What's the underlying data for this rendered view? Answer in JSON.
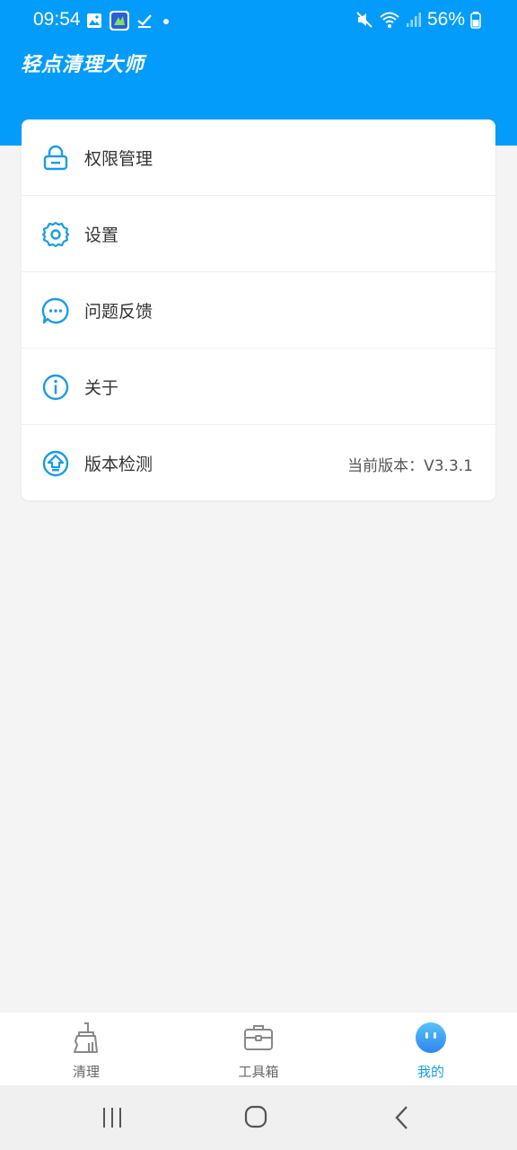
{
  "status_bar": {
    "time": "09:54",
    "battery": "56%",
    "left_icons": [
      "gallery-icon",
      "app-icon",
      "check-icon",
      "dot-icon"
    ],
    "right_icons": [
      "mute-icon",
      "wifi-icon",
      "signal-icon",
      "battery-icon"
    ]
  },
  "header": {
    "title": "轻点清理大师",
    "color": "#039cfa"
  },
  "menu": {
    "items": [
      {
        "label": "权限管理",
        "icon": "lock-icon"
      },
      {
        "label": "设置",
        "icon": "gear-icon"
      },
      {
        "label": "问题反馈",
        "icon": "chat-icon"
      },
      {
        "label": "关于",
        "icon": "info-icon"
      },
      {
        "label": "版本检测",
        "icon": "upgrade-icon",
        "extra": "当前版本：V3.3.1"
      }
    ]
  },
  "bottom_nav": {
    "items": [
      {
        "label": "清理",
        "icon": "broom-icon",
        "active": false
      },
      {
        "label": "工具箱",
        "icon": "toolbox-icon",
        "active": false
      },
      {
        "label": "我的",
        "icon": "face-icon",
        "active": true
      }
    ]
  },
  "accent_color": "#1a9be6"
}
